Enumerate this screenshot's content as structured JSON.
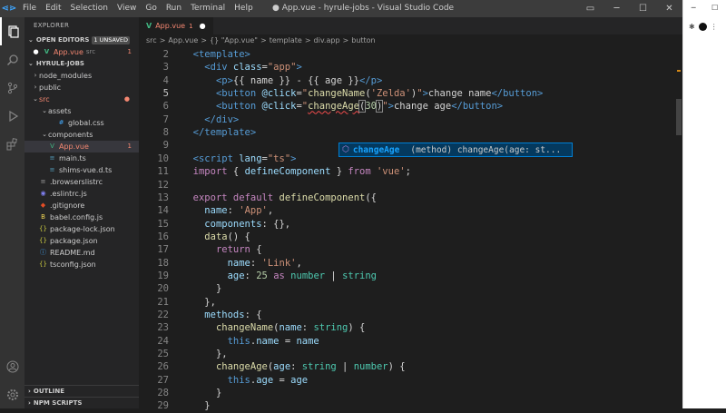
{
  "titlebar": {
    "menu": [
      "File",
      "Edit",
      "Selection",
      "View",
      "Go",
      "Run",
      "Terminal",
      "Help"
    ],
    "title": "● App.vue - hyrule-jobs - Visual Studio Code"
  },
  "sidebar": {
    "header": "EXPLORER",
    "open_editors": "OPEN EDITORS",
    "unsaved_badge": "1 UNSAVED",
    "open_file": {
      "name": "App.vue",
      "path": "src",
      "count": "1"
    },
    "project": "HYRULE-JOBS",
    "tree": [
      {
        "depth": 1,
        "twisty": ">",
        "icon": "folder",
        "name": "node_modules"
      },
      {
        "depth": 1,
        "twisty": ">",
        "icon": "folder",
        "name": "public"
      },
      {
        "depth": 1,
        "twisty": "v",
        "icon": "folder",
        "name": "src",
        "error": true,
        "dot": true
      },
      {
        "depth": 2,
        "twisty": "v",
        "icon": "folder",
        "name": "assets"
      },
      {
        "depth": 3,
        "twisty": "",
        "icon": "css",
        "name": "global.css"
      },
      {
        "depth": 2,
        "twisty": "v",
        "icon": "folder",
        "name": "components"
      },
      {
        "depth": 2,
        "twisty": "",
        "icon": "vue",
        "name": "App.vue",
        "error": true,
        "count": "1",
        "selected": true
      },
      {
        "depth": 2,
        "twisty": "",
        "icon": "ts",
        "name": "main.ts"
      },
      {
        "depth": 2,
        "twisty": "",
        "icon": "ts",
        "name": "shims-vue.d.ts"
      },
      {
        "depth": 1,
        "twisty": "",
        "icon": "cfg",
        "name": ".browserslistrc"
      },
      {
        "depth": 1,
        "twisty": "",
        "icon": "eslint",
        "name": ".eslintrc.js"
      },
      {
        "depth": 1,
        "twisty": "",
        "icon": "git",
        "name": ".gitignore"
      },
      {
        "depth": 1,
        "twisty": "",
        "icon": "babel",
        "name": "babel.config.js"
      },
      {
        "depth": 1,
        "twisty": "",
        "icon": "json",
        "name": "package-lock.json"
      },
      {
        "depth": 1,
        "twisty": "",
        "icon": "json",
        "name": "package.json"
      },
      {
        "depth": 1,
        "twisty": "",
        "icon": "md",
        "name": "README.md"
      },
      {
        "depth": 1,
        "twisty": "",
        "icon": "json",
        "name": "tsconfig.json"
      }
    ],
    "outline": "OUTLINE",
    "npm_scripts": "NPM SCRIPTS"
  },
  "editor": {
    "tab": {
      "name": "App.vue",
      "count": "1"
    },
    "breadcrumb": [
      "src",
      ">",
      "App.vue",
      ">",
      "{} \"App.vue\"",
      ">",
      "template",
      ">",
      "div.app",
      ">",
      "button"
    ],
    "first_line": 2,
    "current_line": 5,
    "lines": [
      [
        [
          "  ",
          "p"
        ],
        [
          "<template>",
          "tag"
        ]
      ],
      [
        [
          "    ",
          "p"
        ],
        [
          "<div ",
          "tag"
        ],
        [
          "class",
          "attr"
        ],
        [
          "=",
          "p"
        ],
        [
          "\"app\"",
          "str"
        ],
        [
          ">",
          "tag"
        ]
      ],
      [
        [
          "      ",
          "p"
        ],
        [
          "<p>",
          "tag"
        ],
        [
          "{{ name }} - {{ age }}",
          "p"
        ],
        [
          "</p>",
          "tag"
        ]
      ],
      [
        [
          "      ",
          "p"
        ],
        [
          "<button ",
          "tag"
        ],
        [
          "@click",
          "attr"
        ],
        [
          "=",
          "p"
        ],
        [
          "\"",
          "str"
        ],
        [
          "changeName",
          "fn"
        ],
        [
          "(",
          "p"
        ],
        [
          "'Zelda'",
          "str"
        ],
        [
          ")",
          "p"
        ],
        [
          "\"",
          "str"
        ],
        [
          ">",
          "tag"
        ],
        [
          "change name",
          "p"
        ],
        [
          "</button>",
          "tag"
        ]
      ],
      [
        [
          "      ",
          "p"
        ],
        [
          "<button ",
          "tag"
        ],
        [
          "@click",
          "attr"
        ],
        [
          "=",
          "p"
        ],
        [
          "\"",
          "str"
        ],
        [
          "changeAge",
          "fnsq"
        ],
        [
          "(",
          "br"
        ],
        [
          "30",
          "num"
        ],
        [
          ")",
          "br"
        ],
        [
          "\"",
          "str"
        ],
        [
          ">",
          "tag"
        ],
        [
          "change age",
          "p"
        ],
        [
          "</button>",
          "tag"
        ]
      ],
      [
        [
          "    ",
          "p"
        ],
        [
          "</div>",
          "tag"
        ]
      ],
      [
        [
          "  ",
          "p"
        ],
        [
          "</template>",
          "tag"
        ]
      ],
      [
        [
          "",
          "p"
        ]
      ],
      [
        [
          "  ",
          "p"
        ],
        [
          "<script ",
          "tag"
        ],
        [
          "lang",
          "attr"
        ],
        [
          "=",
          "p"
        ],
        [
          "\"ts\"",
          "str"
        ],
        [
          ">",
          "tag"
        ]
      ],
      [
        [
          "  ",
          "p"
        ],
        [
          "import",
          "kw"
        ],
        [
          " { ",
          "p"
        ],
        [
          "defineComponent",
          "var"
        ],
        [
          " } ",
          "p"
        ],
        [
          "from",
          "kw"
        ],
        [
          " ",
          "p"
        ],
        [
          "'vue'",
          "str"
        ],
        [
          ";",
          "p"
        ]
      ],
      [
        [
          "",
          "p"
        ]
      ],
      [
        [
          "  ",
          "p"
        ],
        [
          "export",
          "kw"
        ],
        [
          " ",
          "p"
        ],
        [
          "default",
          "kw"
        ],
        [
          " ",
          "p"
        ],
        [
          "defineComponent",
          "fn"
        ],
        [
          "({",
          "p"
        ]
      ],
      [
        [
          "    ",
          "p"
        ],
        [
          "name",
          "var"
        ],
        [
          ": ",
          "p"
        ],
        [
          "'App'",
          "str"
        ],
        [
          ",",
          "p"
        ]
      ],
      [
        [
          "    ",
          "p"
        ],
        [
          "components",
          "var"
        ],
        [
          ": {},",
          "p"
        ]
      ],
      [
        [
          "    ",
          "p"
        ],
        [
          "data",
          "fn"
        ],
        [
          "() {",
          "p"
        ]
      ],
      [
        [
          "      ",
          "p"
        ],
        [
          "return",
          "kw"
        ],
        [
          " {",
          "p"
        ]
      ],
      [
        [
          "        ",
          "p"
        ],
        [
          "name",
          "var"
        ],
        [
          ": ",
          "p"
        ],
        [
          "'Link'",
          "str"
        ],
        [
          ",",
          "p"
        ]
      ],
      [
        [
          "        ",
          "p"
        ],
        [
          "age",
          "var"
        ],
        [
          ": ",
          "p"
        ],
        [
          "25",
          "num"
        ],
        [
          " ",
          "p"
        ],
        [
          "as",
          "kw"
        ],
        [
          " ",
          "p"
        ],
        [
          "number",
          "ty"
        ],
        [
          " | ",
          "p"
        ],
        [
          "string",
          "ty"
        ]
      ],
      [
        [
          "      ",
          "p"
        ],
        [
          "}",
          "p"
        ]
      ],
      [
        [
          "    ",
          "p"
        ],
        [
          "},",
          "p"
        ]
      ],
      [
        [
          "    ",
          "p"
        ],
        [
          "methods",
          "var"
        ],
        [
          ": {",
          "p"
        ]
      ],
      [
        [
          "      ",
          "p"
        ],
        [
          "changeName",
          "fn"
        ],
        [
          "(",
          "p"
        ],
        [
          "name",
          "var"
        ],
        [
          ": ",
          "p"
        ],
        [
          "string",
          "ty"
        ],
        [
          ") {",
          "p"
        ]
      ],
      [
        [
          "        ",
          "p"
        ],
        [
          "this",
          "k2"
        ],
        [
          ".",
          "p"
        ],
        [
          "name",
          "var"
        ],
        [
          " = ",
          "p"
        ],
        [
          "name",
          "var"
        ]
      ],
      [
        [
          "      ",
          "p"
        ],
        [
          "},",
          "p"
        ]
      ],
      [
        [
          "      ",
          "p"
        ],
        [
          "changeAge",
          "fn"
        ],
        [
          "(",
          "p"
        ],
        [
          "age",
          "var"
        ],
        [
          ": ",
          "p"
        ],
        [
          "string",
          "ty"
        ],
        [
          " | ",
          "p"
        ],
        [
          "number",
          "ty"
        ],
        [
          ") {",
          "p"
        ]
      ],
      [
        [
          "        ",
          "p"
        ],
        [
          "this",
          "k2"
        ],
        [
          ".",
          "p"
        ],
        [
          "age",
          "var"
        ],
        [
          " = ",
          "p"
        ],
        [
          "age",
          "var"
        ]
      ],
      [
        [
          "      ",
          "p"
        ],
        [
          "}",
          "p"
        ]
      ],
      [
        [
          "    ",
          "p"
        ],
        [
          "}",
          "p"
        ]
      ]
    ],
    "suggestion": {
      "label": "changeAge",
      "detail": "(method) changeAge(age: st..."
    }
  },
  "colors": {
    "accent": "#007acc",
    "error": "#f48771",
    "vue": "#41b883"
  }
}
